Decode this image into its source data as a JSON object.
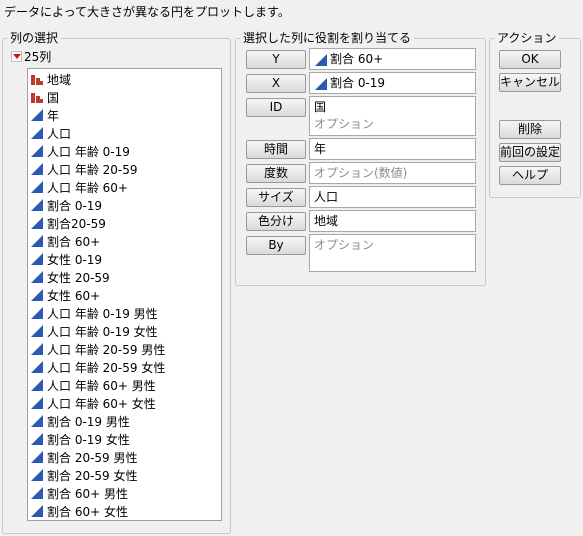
{
  "instruction": "データによって大きさが異なる円をプロットします。",
  "columns_panel": {
    "legend": "列の選択",
    "count_label": "25列",
    "columns": [
      {
        "name": "地域",
        "icon": "nominal-bar-icon"
      },
      {
        "name": "国",
        "icon": "nominal-bar-icon"
      },
      {
        "name": "年",
        "icon": "continuous-triangle-icon"
      },
      {
        "name": "人口",
        "icon": "continuous-triangle-icon"
      },
      {
        "name": "人口 年齢 0-19",
        "icon": "continuous-triangle-icon"
      },
      {
        "name": "人口 年齢 20-59",
        "icon": "continuous-triangle-icon"
      },
      {
        "name": "人口 年齢 60+",
        "icon": "continuous-triangle-icon"
      },
      {
        "name": "割合 0-19",
        "icon": "continuous-triangle-icon"
      },
      {
        "name": "割合20-59",
        "icon": "continuous-triangle-icon"
      },
      {
        "name": "割合 60+",
        "icon": "continuous-triangle-icon"
      },
      {
        "name": "女性 0-19",
        "icon": "continuous-triangle-icon"
      },
      {
        "name": "女性 20-59",
        "icon": "continuous-triangle-icon"
      },
      {
        "name": "女性 60+",
        "icon": "continuous-triangle-icon"
      },
      {
        "name": "人口 年齢 0-19 男性",
        "icon": "continuous-triangle-icon"
      },
      {
        "name": "人口 年齢 0-19 女性",
        "icon": "continuous-triangle-icon"
      },
      {
        "name": "人口 年齢 20-59 男性",
        "icon": "continuous-triangle-icon"
      },
      {
        "name": "人口 年齢 20-59 女性",
        "icon": "continuous-triangle-icon"
      },
      {
        "name": "人口 年齢 60+ 男性",
        "icon": "continuous-triangle-icon"
      },
      {
        "name": "人口 年齢 60+ 女性",
        "icon": "continuous-triangle-icon"
      },
      {
        "name": "割合 0-19 男性",
        "icon": "continuous-triangle-icon"
      },
      {
        "name": "割合 0-19 女性",
        "icon": "continuous-triangle-icon"
      },
      {
        "name": "割合 20-59 男性",
        "icon": "continuous-triangle-icon"
      },
      {
        "name": "割合 20-59 女性",
        "icon": "continuous-triangle-icon"
      },
      {
        "name": "割合 60+ 男性",
        "icon": "continuous-triangle-icon"
      },
      {
        "name": "割合 60+ 女性",
        "icon": "continuous-triangle-icon"
      }
    ]
  },
  "roles_panel": {
    "legend": "選択した列に役割を割り当てる",
    "roles": [
      {
        "button": "Y",
        "value": "割合 60+",
        "value_icon": "continuous-triangle-icon",
        "placeholder": ""
      },
      {
        "button": "X",
        "value": "割合 0-19",
        "value_icon": "continuous-triangle-icon",
        "placeholder": ""
      },
      {
        "button": "ID",
        "value": "国",
        "placeholder": "オプション"
      },
      {
        "button": "時間",
        "value": "年",
        "placeholder": ""
      },
      {
        "button": "度数",
        "value": "",
        "placeholder": "オプション(数値)"
      },
      {
        "button": "サイズ",
        "value": "人口",
        "placeholder": ""
      },
      {
        "button": "色分け",
        "value": "地域",
        "placeholder": ""
      },
      {
        "button": "By",
        "value": "",
        "placeholder": "オプション"
      }
    ]
  },
  "actions_panel": {
    "legend": "アクション",
    "ok": "OK",
    "cancel": "キャンセル",
    "remove": "削除",
    "recall": "前回の設定",
    "help": "ヘルプ"
  },
  "colors": {
    "nominal_icon": "#c0392b",
    "continuous_icon": "#2a5bb0",
    "collapse_triangle": "#d01010"
  }
}
